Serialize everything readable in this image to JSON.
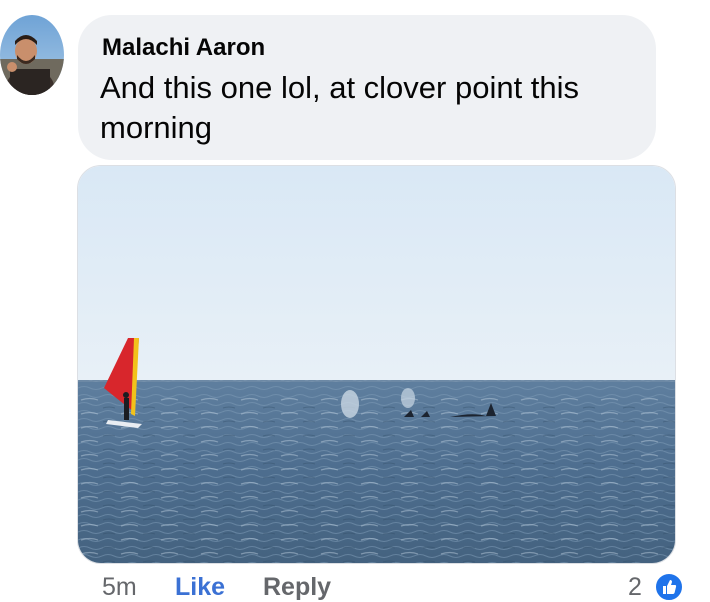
{
  "comment": {
    "author": "Malachi Aaron",
    "text": "And this one lol, at clover point this morning",
    "avatar_icon": "user-avatar-photo",
    "photo_description_icon": "attached-photo"
  },
  "actions": {
    "timestamp": "5m",
    "like_label": "Like",
    "reply_label": "Reply",
    "reaction_count": "2",
    "reaction_icon": "thumbs-up-icon"
  },
  "colors": {
    "bubble": "#eff1f4",
    "like_link": "#3b71d4",
    "muted_text": "#65676b",
    "like_badge": "#1f73ea"
  }
}
